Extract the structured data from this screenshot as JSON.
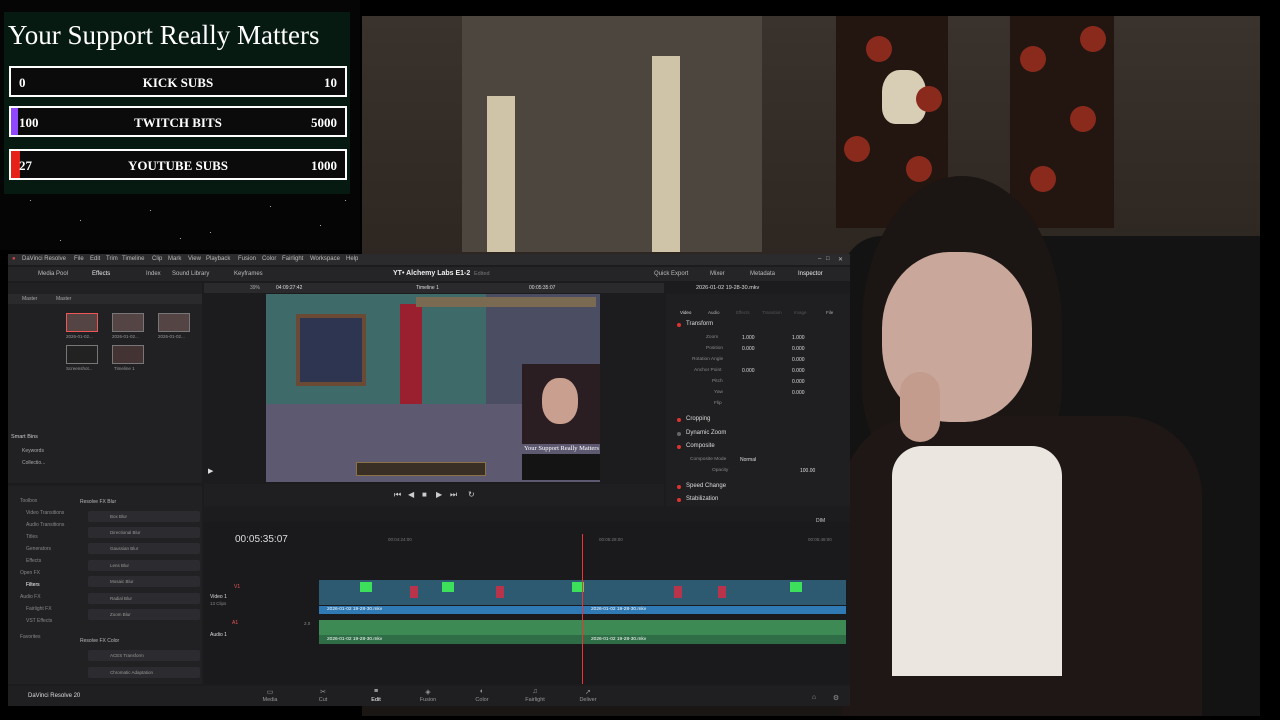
{
  "overlay": {
    "title": "Your Support Really Matters",
    "goals": [
      {
        "start": "0",
        "label": "KICK SUBS",
        "end": "10",
        "progress": 0.0,
        "color": "#2ecc40"
      },
      {
        "start": "100",
        "label": "TWITCH BITS",
        "end": "5000",
        "progress": 0.02,
        "color": "#9146ff"
      },
      {
        "start": "27",
        "label": "YOUTUBE SUBS",
        "end": "1000",
        "progress": 0.027,
        "color": "#e62117"
      }
    ]
  },
  "app": {
    "name": "DaVinci Resolve",
    "menu": [
      "DaVinci Resolve",
      "File",
      "Edit",
      "Trim",
      "Timeline",
      "Clip",
      "Mark",
      "View",
      "Playback",
      "Fusion",
      "Color",
      "Fairlight",
      "Workspace",
      "Help"
    ],
    "toolbar_left": [
      "Media Pool",
      "Effects",
      "Index",
      "Sound Library",
      "Keyframes"
    ],
    "toolbar_right": [
      "Quick Export",
      "Mixer",
      "Metadata",
      "Inspector"
    ],
    "project_title": "YT• Alchemy Labs E1-2",
    "project_status": "Edited"
  },
  "media_pool": {
    "tabs": [
      "Master",
      "Master"
    ],
    "clips": [
      "2026-01-02...",
      "2026-01-02...",
      "2026-01-02...",
      "Screenshot...",
      "Timeline 1"
    ],
    "smart_bins": "Smart Bins",
    "smart_items": [
      "Keywords",
      "Collectio..."
    ]
  },
  "viewer": {
    "zoom": "39%",
    "source_timecode": "04:09:27:42",
    "timeline_name": "Timeline 1",
    "record_timecode": "00:05:35:07",
    "overlay_text": "Your Support Really Matters"
  },
  "inspector": {
    "clip_name": "2026-01-02 19-28-30.mkv",
    "tabs": [
      "Video",
      "Audio",
      "Effects",
      "Transition",
      "Image",
      "File"
    ],
    "sections": [
      "Transform",
      "Cropping",
      "Dynamic Zoom",
      "Composite",
      "Speed Change",
      "Stabilization"
    ],
    "transform_rows": [
      {
        "label": "Zoom",
        "x": "1.000",
        "y": "1.000"
      },
      {
        "label": "Position",
        "x": "0.000",
        "y": "0.000"
      },
      {
        "label": "Rotation Angle",
        "x": "",
        "y": "0.000"
      },
      {
        "label": "Anchor Point",
        "x": "0.000",
        "y": "0.000"
      },
      {
        "label": "Pitch",
        "x": "",
        "y": "0.000"
      },
      {
        "label": "Yaw",
        "x": "",
        "y": "0.000"
      },
      {
        "label": "Flip",
        "x": "",
        "y": ""
      }
    ],
    "composite_mode_label": "Composite Mode",
    "composite_mode": "Normal",
    "opacity_label": "Opacity",
    "opacity": "100.00"
  },
  "effects": {
    "tree": [
      "Toolbox",
      "Video Transitions",
      "Audio Transitions",
      "Titles",
      "Generators",
      "Effects",
      "Open FX",
      "Filters",
      "Audio FX",
      "Fairlight FX",
      "VST Effects",
      "Favorites"
    ],
    "group1": "Resolve FX Blur",
    "group1_items": [
      "Box Blur",
      "Directional Blur",
      "Gaussian Blur",
      "Lens Blur",
      "Mosaic Blur",
      "Radial Blur",
      "Zoom Blur"
    ],
    "group2": "Resolve FX Color",
    "group2_items": [
      "ACES Transform",
      "Chromatic Adaptation"
    ]
  },
  "timeline": {
    "timecode": "00:05:35:07",
    "ruler": [
      "00:04:24:00",
      "00:05:28:00",
      "00:05:48:00"
    ],
    "video_track": {
      "id": "V1",
      "name": "Video 1",
      "count": "13 Clips"
    },
    "audio_track": {
      "id": "A1",
      "name": "Audio 1",
      "level": "2.0"
    },
    "clip_name": "2026-01-02 19-28-30.mkv",
    "dim_label": "DIM"
  },
  "pages": [
    "Media",
    "Cut",
    "Edit",
    "Fusion",
    "Color",
    "Fairlight",
    "Deliver"
  ],
  "active_page": "Edit",
  "brand": "DaVinci Resolve 20"
}
